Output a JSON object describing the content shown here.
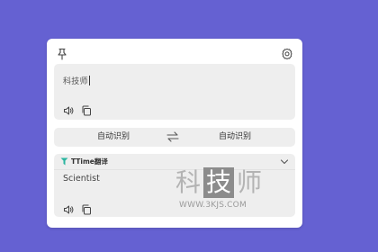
{
  "source": {
    "text": "科技师"
  },
  "language_bar": {
    "source_lang": "自动识别",
    "target_lang": "自动识别"
  },
  "result": {
    "engine_name": "TTime翻译",
    "text": "Scientist"
  },
  "watermark": {
    "chars": [
      "科",
      "技",
      "师"
    ],
    "url": "WWW.3KJS.COM"
  },
  "icons": [
    "pin-icon",
    "settings-icon",
    "speaker-icon",
    "copy-icon",
    "swap-icon",
    "engine-logo-icon",
    "chevron-down-icon"
  ],
  "colors": {
    "background": "#6561d2",
    "card": "#ffffff",
    "panel": "#eeeeee"
  }
}
